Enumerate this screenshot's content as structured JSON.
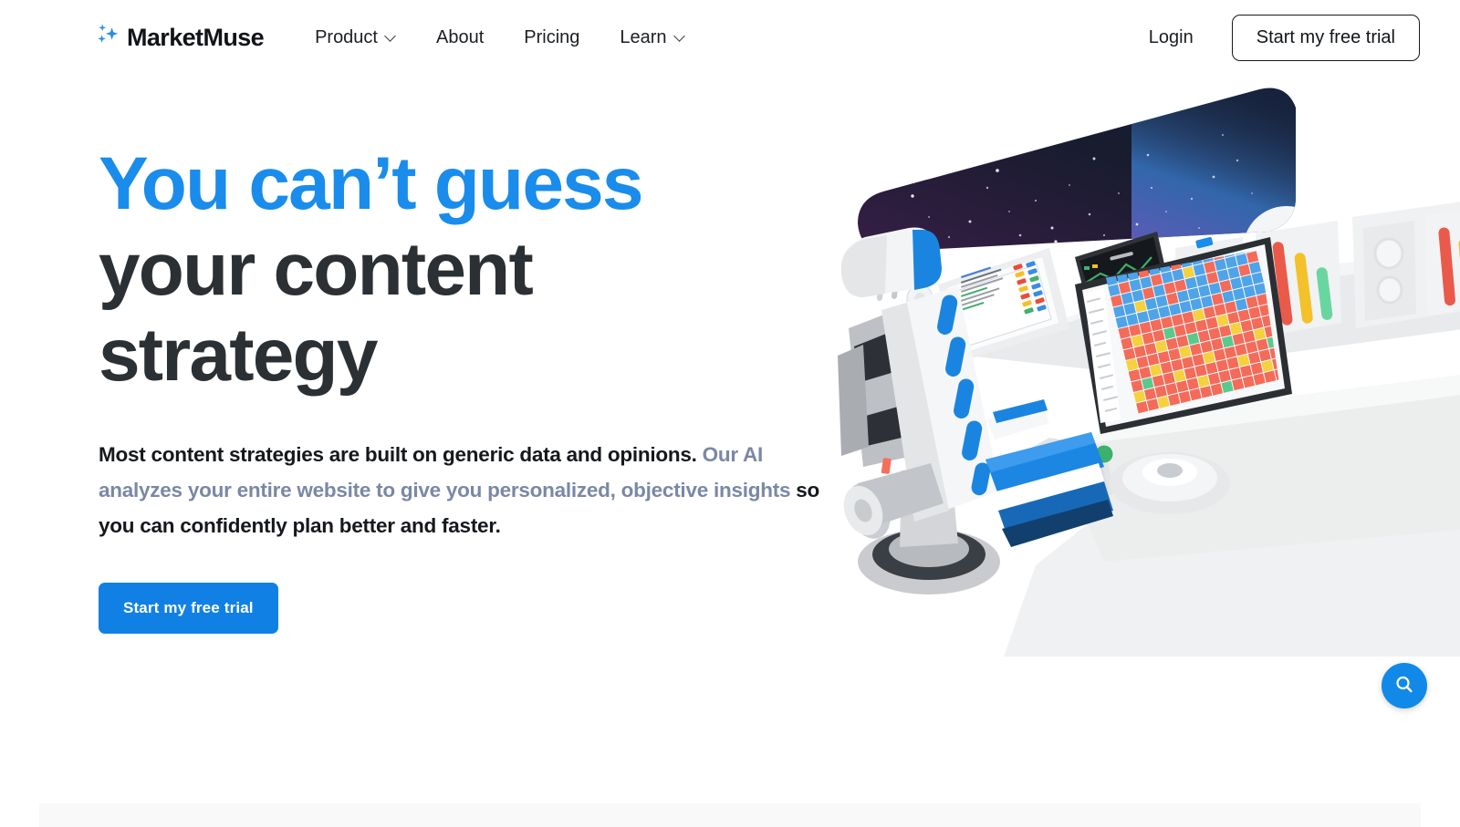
{
  "brand": {
    "name": "MarketMuse",
    "mark_icon": "sparkles-icon"
  },
  "nav": {
    "items": [
      {
        "label": "Product",
        "has_dropdown": true,
        "icon": "chevron-down-icon"
      },
      {
        "label": "About",
        "has_dropdown": false,
        "icon": ""
      },
      {
        "label": "Pricing",
        "has_dropdown": false,
        "icon": ""
      },
      {
        "label": "Learn",
        "has_dropdown": true,
        "icon": "chevron-down-icon"
      }
    ]
  },
  "header_actions": {
    "login_label": "Login",
    "trial_label": "Start my free trial"
  },
  "hero": {
    "headline_line1": "You can’t guess",
    "headline_line2": "your content",
    "headline_line3": "strategy",
    "subcopy_part1": "Most content strategies are built on generic data and opinions. ",
    "subcopy_highlight": "Our AI analyzes your entire website to give you personalized, objective insights",
    "subcopy_part2": " so you can confidently plan better and faster.",
    "cta_label": "Start my free trial"
  },
  "floating": {
    "search_icon": "search-icon",
    "search_label": "Search"
  },
  "illustration": {
    "name": "spaceship-cockpit-illustration",
    "alt": "Spaceship cockpit with captain chair, space window with stars, and dashboard monitors showing content analytics"
  },
  "colors": {
    "accent_blue": "#1a8ceb",
    "cta_blue": "#1180e4",
    "headline_dark": "#2b2f33",
    "muted_slate": "#7a88a5",
    "text_dark": "#15181c",
    "band_gray": "#f9f9fa",
    "space_purple": "#3d1f4d",
    "space_navy": "#111a2e"
  }
}
